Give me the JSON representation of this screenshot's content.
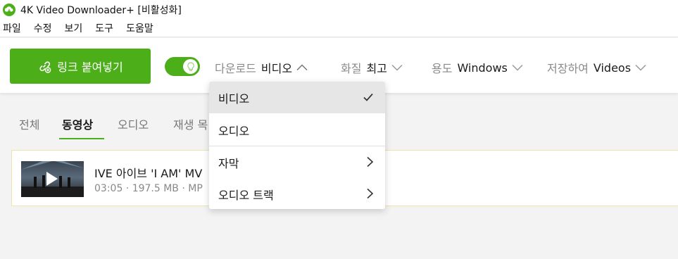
{
  "window": {
    "title": "4K Video Downloader+ [비활성화]"
  },
  "menu": [
    "파일",
    "수정",
    "보기",
    "도구",
    "도움말"
  ],
  "toolbar": {
    "paste_label": "링크 붙여넣기",
    "download": {
      "label": "다운로드",
      "value": "비디오"
    },
    "quality": {
      "label": "화질",
      "value": "최고"
    },
    "usage": {
      "label": "용도",
      "value": "Windows"
    },
    "save": {
      "label": "저장하여",
      "value": "Videos"
    }
  },
  "tabs": [
    "전체",
    "동영상",
    "오디오",
    "재생 목"
  ],
  "item": {
    "title": "IVE 아이브 'I AM' MV",
    "meta": "03:05 · 197.5 MB · MP"
  },
  "dropdown": {
    "items": [
      {
        "label": "비디오",
        "selected": true,
        "icon": "check-icon"
      },
      {
        "label": "오디오",
        "selected": false
      },
      {
        "label": "자막",
        "selected": false,
        "icon": "chevron-right-icon"
      },
      {
        "label": "오디오 트랙",
        "selected": false,
        "icon": "chevron-right-icon"
      }
    ]
  },
  "colors": {
    "accent": "#4cae18",
    "item_border": "#f0e2a8"
  }
}
